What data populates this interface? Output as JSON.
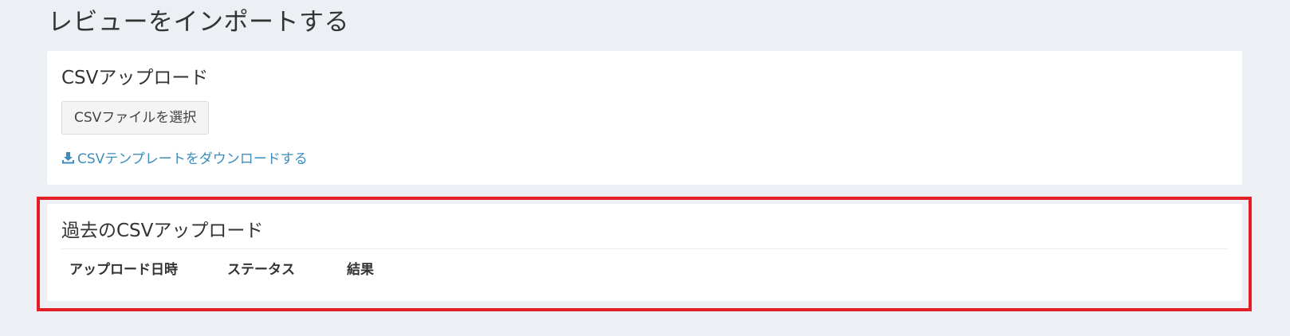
{
  "page": {
    "title": "レビューをインポートする"
  },
  "upload_card": {
    "title": "CSVアップロード",
    "select_file_button": "CSVファイルを選択",
    "template_link": "CSVテンプレートをダウンロードする",
    "template_link_icon": "download-icon"
  },
  "history_card": {
    "title": "過去のCSVアップロード",
    "table": {
      "columns": [
        "アップロード日時",
        "ステータス",
        "結果"
      ],
      "rows": []
    }
  },
  "colors": {
    "background": "#eceff3",
    "card": "#ffffff",
    "link": "#3c8dbc",
    "highlight": "#e21e26"
  }
}
